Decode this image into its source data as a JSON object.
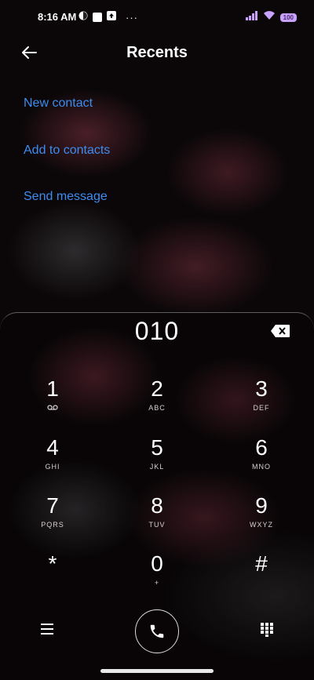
{
  "status_bar": {
    "time": "8:16 AM",
    "battery": "100",
    "overflow": "···"
  },
  "header": {
    "title": "Recents"
  },
  "actions": {
    "new_contact": "New contact",
    "add_to_contacts": "Add to contacts",
    "send_message": "Send message"
  },
  "dialer": {
    "number": "010"
  },
  "keys": [
    {
      "digit": "1",
      "letters": ""
    },
    {
      "digit": "2",
      "letters": "ABC"
    },
    {
      "digit": "3",
      "letters": "DEF"
    },
    {
      "digit": "4",
      "letters": "GHI"
    },
    {
      "digit": "5",
      "letters": "JKL"
    },
    {
      "digit": "6",
      "letters": "MNO"
    },
    {
      "digit": "7",
      "letters": "PQRS"
    },
    {
      "digit": "8",
      "letters": "TUV"
    },
    {
      "digit": "9",
      "letters": "WXYZ"
    },
    {
      "digit": "*",
      "letters": ""
    },
    {
      "digit": "0",
      "letters": "+"
    },
    {
      "digit": "#",
      "letters": ""
    }
  ],
  "colors": {
    "link": "#3d8cf0",
    "background": "#0b0708",
    "accent_wallpaper": "#963c50"
  },
  "icons": {
    "back": "arrow-left-icon",
    "backspace": "backspace-icon",
    "menu": "hamburger-menu-icon",
    "call": "phone-icon",
    "keypad": "dialpad-icon",
    "voicemail": "voicemail-icon"
  }
}
